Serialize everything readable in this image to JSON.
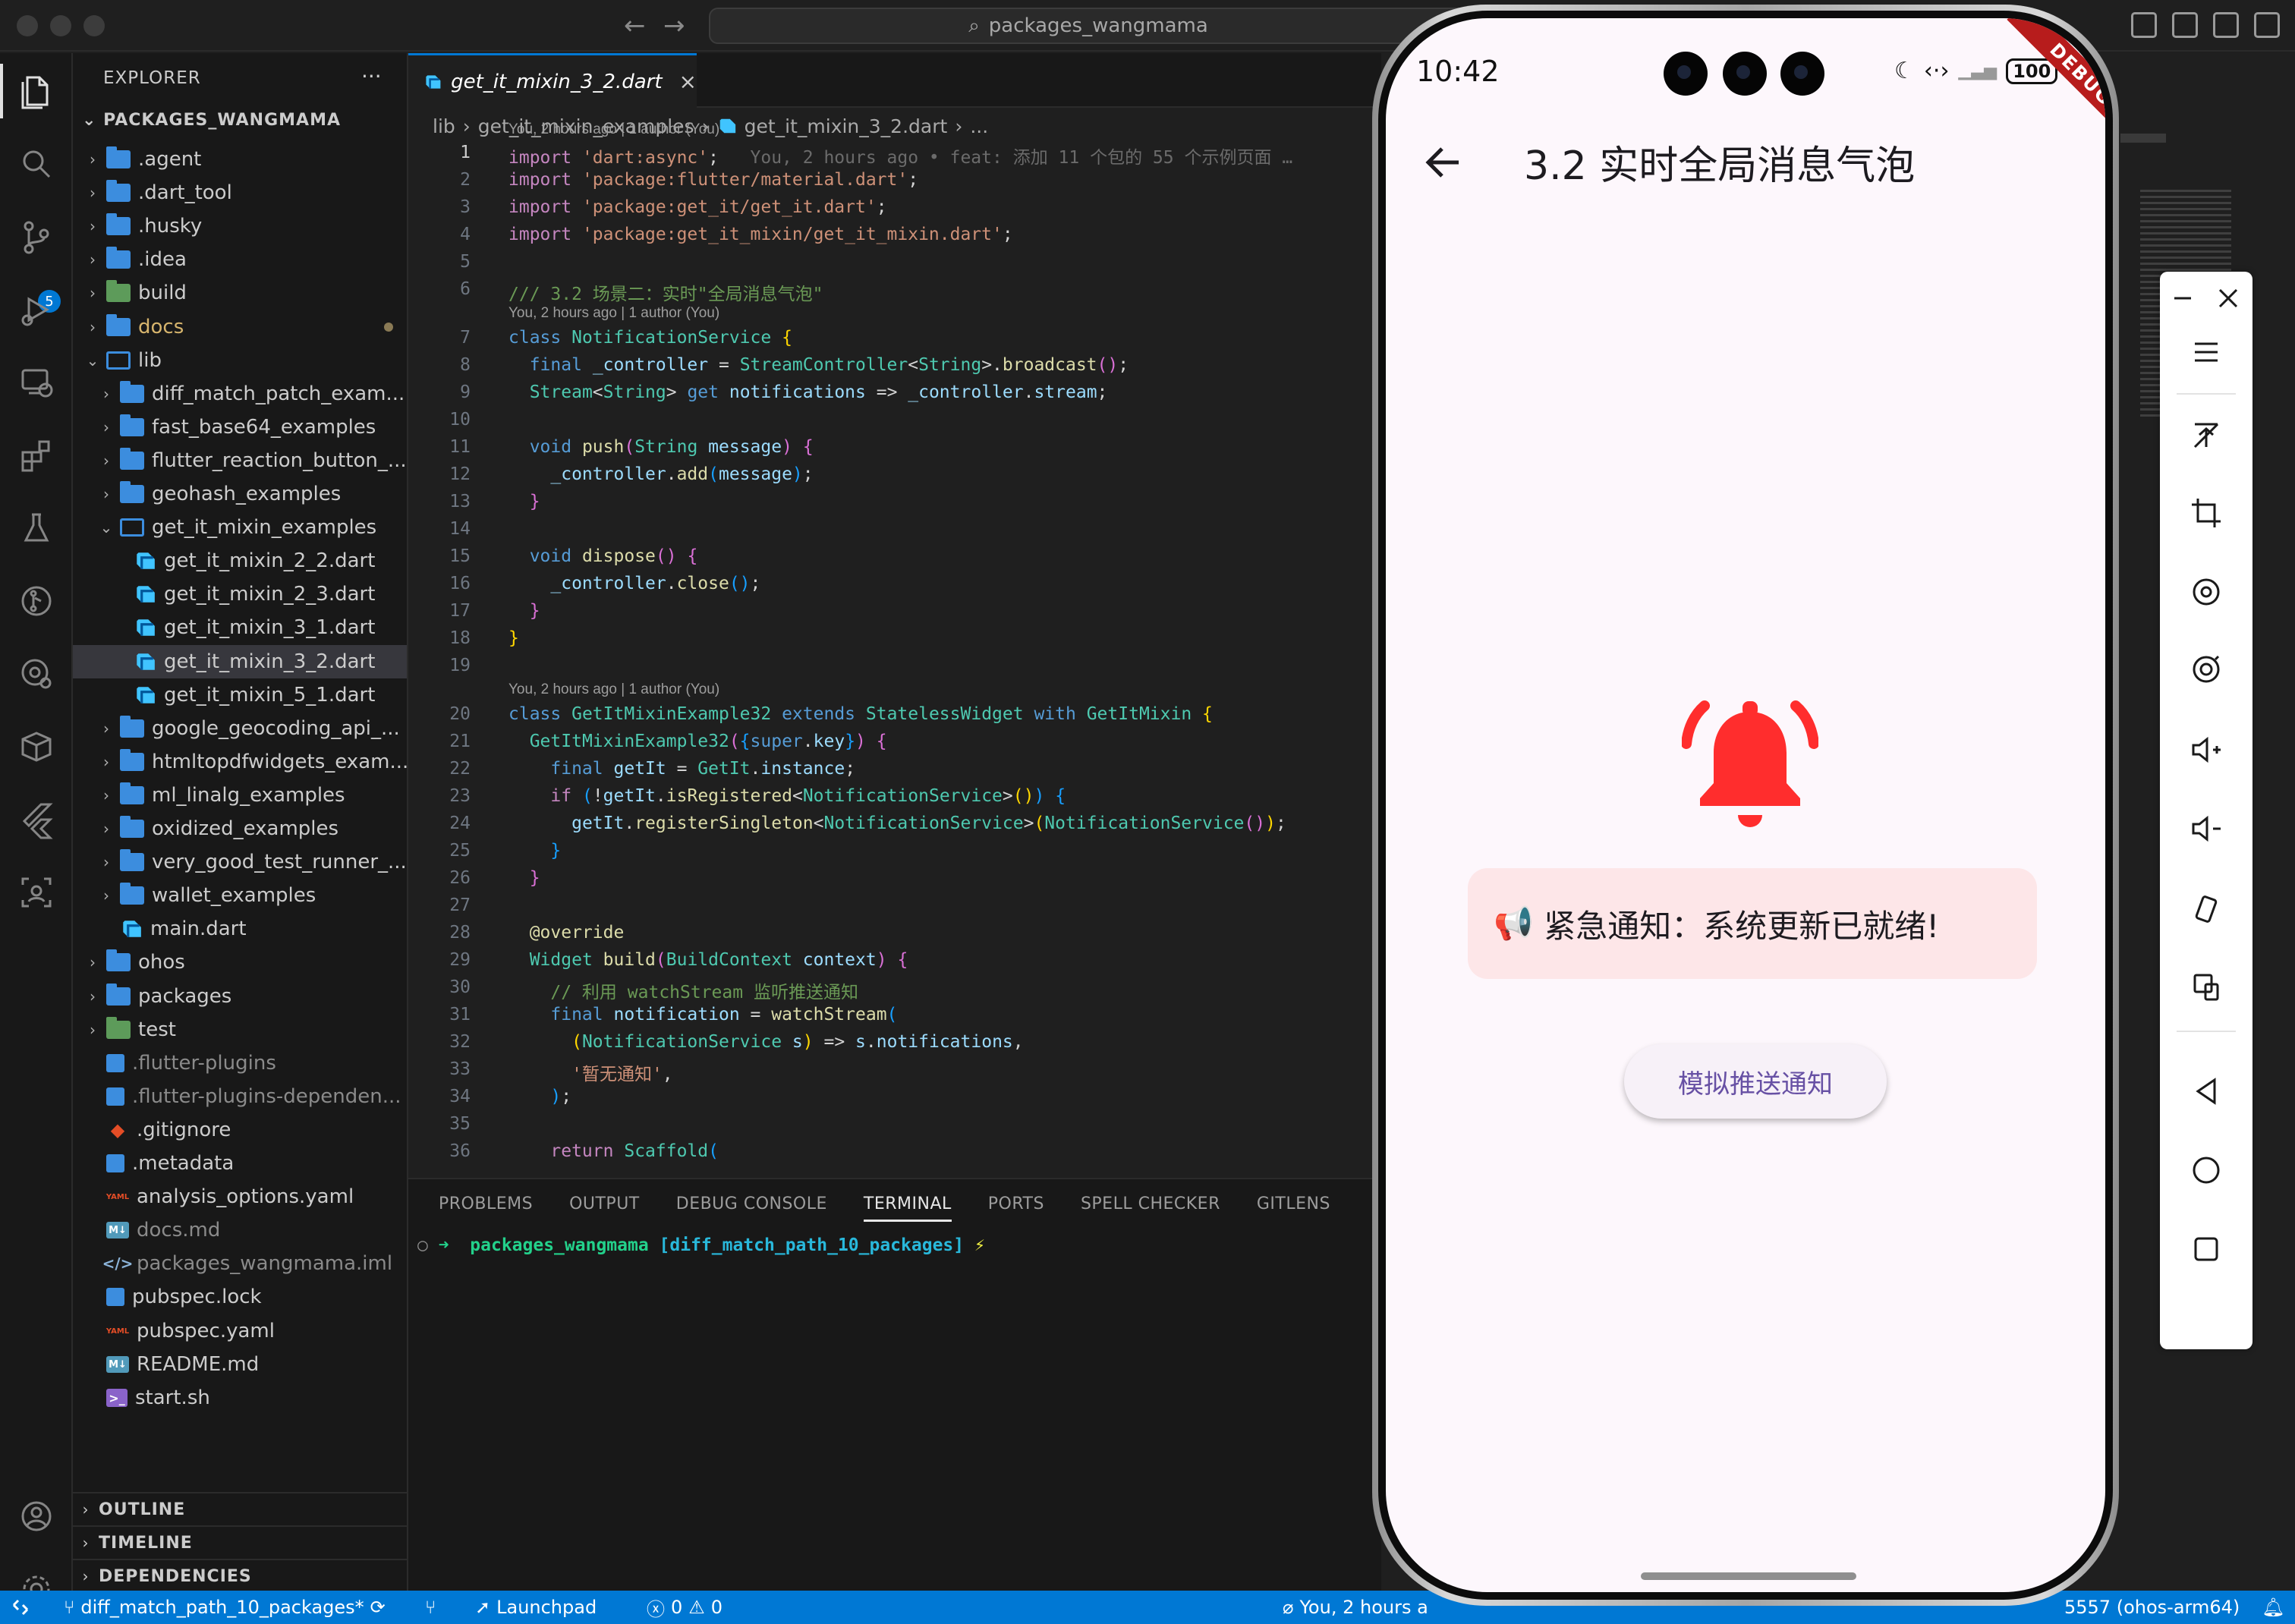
{
  "window": {
    "search_text": "packages_wangmama"
  },
  "activity_bar": {
    "scm_badge": "5",
    "icons": [
      "files-icon",
      "search-icon",
      "source-control-icon",
      "run-debug-icon",
      "remote-explorer-icon",
      "extensions-icon",
      "testing-icon",
      "git-graph-icon",
      "gitlens-icon",
      "containers-icon",
      "flutter-icon",
      "scan-icon",
      "account-icon",
      "settings-gear-icon"
    ]
  },
  "explorer": {
    "title": "EXPLORER",
    "more": "···",
    "workspace": "PACKAGES_WANGMAMA",
    "rows": [
      {
        "label": ".agent",
        "kind": "folder",
        "depth": 0,
        "chev": "›"
      },
      {
        "label": ".dart_tool",
        "kind": "folder",
        "depth": 0,
        "chev": "›"
      },
      {
        "label": ".husky",
        "kind": "folder",
        "depth": 0,
        "chev": "›"
      },
      {
        "label": ".idea",
        "kind": "folder",
        "depth": 0,
        "chev": "›"
      },
      {
        "label": "build",
        "kind": "build",
        "depth": 0,
        "chev": "›"
      },
      {
        "label": "docs",
        "kind": "folder",
        "depth": 0,
        "chev": "›",
        "modified": true
      },
      {
        "label": "lib",
        "kind": "open",
        "depth": 0,
        "chev": "⌄"
      },
      {
        "label": "diff_match_patch_exam...",
        "kind": "folder",
        "depth": 1,
        "chev": "›"
      },
      {
        "label": "fast_base64_examples",
        "kind": "folder",
        "depth": 1,
        "chev": "›"
      },
      {
        "label": "flutter_reaction_button_...",
        "kind": "folder",
        "depth": 1,
        "chev": "›"
      },
      {
        "label": "geohash_examples",
        "kind": "folder",
        "depth": 1,
        "chev": "›"
      },
      {
        "label": "get_it_mixin_examples",
        "kind": "open",
        "depth": 1,
        "chev": "⌄"
      },
      {
        "label": "get_it_mixin_2_2.dart",
        "kind": "dart",
        "depth": 2,
        "chev": ""
      },
      {
        "label": "get_it_mixin_2_3.dart",
        "kind": "dart",
        "depth": 2,
        "chev": ""
      },
      {
        "label": "get_it_mixin_3_1.dart",
        "kind": "dart",
        "depth": 2,
        "chev": ""
      },
      {
        "label": "get_it_mixin_3_2.dart",
        "kind": "dart",
        "depth": 2,
        "chev": "",
        "selected": true
      },
      {
        "label": "get_it_mixin_5_1.dart",
        "kind": "dart",
        "depth": 2,
        "chev": ""
      },
      {
        "label": "google_geocoding_api_...",
        "kind": "folder",
        "depth": 1,
        "chev": "›"
      },
      {
        "label": "htmltopdfwidgets_exam...",
        "kind": "folder",
        "depth": 1,
        "chev": "›"
      },
      {
        "label": "ml_linalg_examples",
        "kind": "folder",
        "depth": 1,
        "chev": "›"
      },
      {
        "label": "oxidized_examples",
        "kind": "folder",
        "depth": 1,
        "chev": "›"
      },
      {
        "label": "very_good_test_runner_...",
        "kind": "folder",
        "depth": 1,
        "chev": "›"
      },
      {
        "label": "wallet_examples",
        "kind": "folder",
        "depth": 1,
        "chev": "›"
      },
      {
        "label": "main.dart",
        "kind": "dart",
        "depth": 1,
        "chev": ""
      },
      {
        "label": "ohos",
        "kind": "folder",
        "depth": 0,
        "chev": "›"
      },
      {
        "label": "packages",
        "kind": "folder",
        "depth": 0,
        "chev": "›"
      },
      {
        "label": "test",
        "kind": "build",
        "depth": 0,
        "chev": "›"
      },
      {
        "label": ".flutter-plugins",
        "kind": "file",
        "depth": 0,
        "chev": "",
        "dim": true
      },
      {
        "label": ".flutter-plugins-dependen...",
        "kind": "file",
        "depth": 0,
        "chev": "",
        "dim": true
      },
      {
        "label": ".gitignore",
        "kind": "git",
        "depth": 0,
        "chev": ""
      },
      {
        "label": ".metadata",
        "kind": "meta",
        "depth": 0,
        "chev": ""
      },
      {
        "label": "analysis_options.yaml",
        "kind": "yaml",
        "depth": 0,
        "chev": ""
      },
      {
        "label": "docs.md",
        "kind": "md",
        "depth": 0,
        "chev": "",
        "dim": true
      },
      {
        "label": "packages_wangmama.iml",
        "kind": "xml",
        "depth": 0,
        "chev": "",
        "dim": true
      },
      {
        "label": "pubspec.lock",
        "kind": "meta",
        "depth": 0,
        "chev": ""
      },
      {
        "label": "pubspec.yaml",
        "kind": "yaml",
        "depth": 0,
        "chev": ""
      },
      {
        "label": "README.md",
        "kind": "md",
        "depth": 0,
        "chev": ""
      },
      {
        "label": "start.sh",
        "kind": "sh",
        "depth": 0,
        "chev": ""
      }
    ],
    "sections": [
      "OUTLINE",
      "TIMELINE",
      "DEPENDENCIES"
    ]
  },
  "editor": {
    "tab_label": "get_it_mixin_3_2.dart",
    "tab_close": "×",
    "breadcrumb": [
      "lib",
      "get_it_mixin_examples",
      "get_it_mixin_3_2.dart",
      "..."
    ],
    "blame_top": "You, 2 hours ago | 1 author (You)",
    "inline_blame": "You, 2 hours ago • feat: 添加 11 个包的 55 个示例页面 …",
    "blame_class1": "You, 2 hours ago | 1 author (You)",
    "blame_class2": "You, 2 hours ago | 1 author (You)",
    "line_numbers": [
      "1",
      "2",
      "3",
      "4",
      "5",
      "6",
      "7",
      "8",
      "9",
      "10",
      "11",
      "12",
      "13",
      "14",
      "15",
      "16",
      "17",
      "18",
      "19",
      "20",
      "21",
      "22",
      "23",
      "24",
      "25",
      "26",
      "27",
      "28",
      "29",
      "30",
      "31",
      "32",
      "33",
      "34",
      "35",
      "36"
    ]
  },
  "panel": {
    "tabs": [
      "PROBLEMS",
      "OUTPUT",
      "DEBUG CONSOLE",
      "TERMINAL",
      "PORTS",
      "SPELL CHECKER",
      "GITLENS"
    ],
    "active_tab": "TERMINAL",
    "terminal_dir": "packages_wangmama",
    "terminal_branch": "[diff_match_path_10_packages]",
    "terminal_symbol": "⚡"
  },
  "statusbar": {
    "remote_icon": "remote-icon",
    "branch": "diff_match_path_10_packages*",
    "launchpad": "Launchpad",
    "errors": "0",
    "warnings": "0",
    "blame": "You, 2 hours a",
    "device": "5557 (ohos-arm64)"
  },
  "phone": {
    "time": "10:42",
    "battery": "100",
    "debug_banner": "DEBUG",
    "title": "3.2 实时全局消息气泡",
    "notice_icon": "📢",
    "notice_text": "紧急通知：系统更新已就绪!",
    "button_label": "模拟推送通知",
    "bell_color": "#ff2d2d"
  },
  "emulator_toolbar": {
    "icons": [
      "minimize-icon",
      "close-icon",
      "menu-icon",
      "pin-icon",
      "crop-icon",
      "rotate-icon",
      "screenshot-icon",
      "volume-up-icon",
      "volume-down-icon",
      "rotate-device-icon",
      "multi-screen-icon",
      "back-triangle-icon",
      "home-circle-icon",
      "recents-square-icon"
    ]
  }
}
